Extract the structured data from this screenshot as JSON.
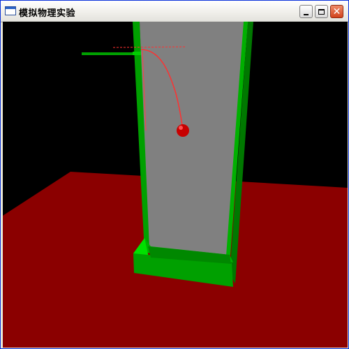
{
  "window": {
    "title": "模拟物理实验",
    "buttons": {
      "minimize": "minimize",
      "maximize": "maximize",
      "close": "✕"
    }
  },
  "scene": {
    "colors": {
      "background": "#000000",
      "floor": "#8b0000",
      "board": "#808080",
      "frame": "#00a000",
      "ball": "#d00000",
      "trajectory": "#ff3030"
    }
  }
}
